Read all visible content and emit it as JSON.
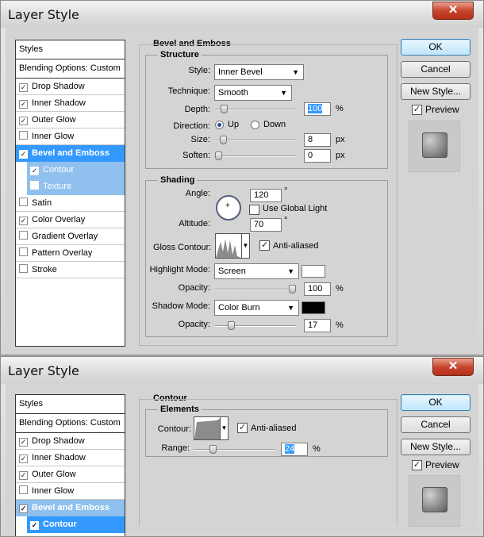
{
  "dialog1": {
    "title": "Layer Style",
    "close": "✕",
    "styles": [
      {
        "label": "Styles",
        "type": "hdr"
      },
      {
        "label": "Blending Options: Custom",
        "type": "hdr"
      },
      {
        "label": "Drop Shadow",
        "checked": true
      },
      {
        "label": "Inner Shadow",
        "checked": true
      },
      {
        "label": "Outer Glow",
        "checked": true
      },
      {
        "label": "Inner Glow",
        "checked": false
      },
      {
        "label": "Bevel and Emboss",
        "checked": true,
        "state": "sel"
      },
      {
        "label": "Contour",
        "checked": true,
        "state": "sub"
      },
      {
        "label": "Texture",
        "checked": false,
        "state": "sub"
      },
      {
        "label": "Satin",
        "checked": false
      },
      {
        "label": "Color Overlay",
        "checked": true
      },
      {
        "label": "Gradient Overlay",
        "checked": false
      },
      {
        "label": "Pattern Overlay",
        "checked": false
      },
      {
        "label": "Stroke",
        "checked": false
      }
    ],
    "section_title": "Bevel and Emboss",
    "structure": {
      "title": "Structure",
      "style_label": "Style:",
      "style_value": "Inner Bevel",
      "technique_label": "Technique:",
      "technique_value": "Smooth",
      "depth_label": "Depth:",
      "depth_value": "100",
      "depth_unit": "%",
      "depth_slider": 0.08,
      "direction_label": "Direction:",
      "dir_up": "Up",
      "dir_down": "Down",
      "size_label": "Size:",
      "size_value": "8",
      "size_unit": "px",
      "size_slider": 0.06,
      "soften_label": "Soften:",
      "soften_value": "0",
      "soften_unit": "px",
      "soften_slider": 0.0
    },
    "shading": {
      "title": "Shading",
      "angle_label": "Angle:",
      "angle_value": "120",
      "angle_unit": "°",
      "global_light": "Use Global Light",
      "altitude_label": "Altitude:",
      "altitude_value": "70",
      "altitude_unit": "°",
      "gloss_label": "Gloss Contour:",
      "anti_aliased": "Anti-aliased",
      "highlight_label": "Highlight Mode:",
      "highlight_value": "Screen",
      "highlight_color": "#ffffff",
      "hl_opacity_label": "Opacity:",
      "hl_opacity_value": "100",
      "hl_opacity_unit": "%",
      "hl_opacity_slider": 1.0,
      "shadow_label": "Shadow Mode:",
      "shadow_value": "Color Burn",
      "shadow_color": "#000000",
      "sh_opacity_label": "Opacity:",
      "sh_opacity_value": "17",
      "sh_opacity_unit": "%",
      "sh_opacity_slider": 0.17
    },
    "buttons": {
      "ok": "OK",
      "cancel": "Cancel",
      "new_style": "New Style...",
      "preview": "Preview"
    }
  },
  "dialog2": {
    "title": "Layer Style",
    "close": "✕",
    "styles": [
      {
        "label": "Styles",
        "type": "hdr"
      },
      {
        "label": "Blending Options: Custom",
        "type": "hdr"
      },
      {
        "label": "Drop Shadow",
        "checked": true
      },
      {
        "label": "Inner Shadow",
        "checked": true
      },
      {
        "label": "Outer Glow",
        "checked": true
      },
      {
        "label": "Inner Glow",
        "checked": false
      },
      {
        "label": "Bevel and Emboss",
        "checked": true,
        "state": "sub2"
      },
      {
        "label": "Contour",
        "checked": true,
        "state": "subsel"
      }
    ],
    "section_title": "Contour",
    "elements": {
      "title": "Elements",
      "contour_label": "Contour:",
      "anti_aliased": "Anti-aliased",
      "range_label": "Range:",
      "range_value": "24",
      "range_unit": "%",
      "range_slider": 0.22
    },
    "buttons": {
      "ok": "OK",
      "cancel": "Cancel",
      "new_style": "New Style...",
      "preview": "Preview"
    }
  }
}
